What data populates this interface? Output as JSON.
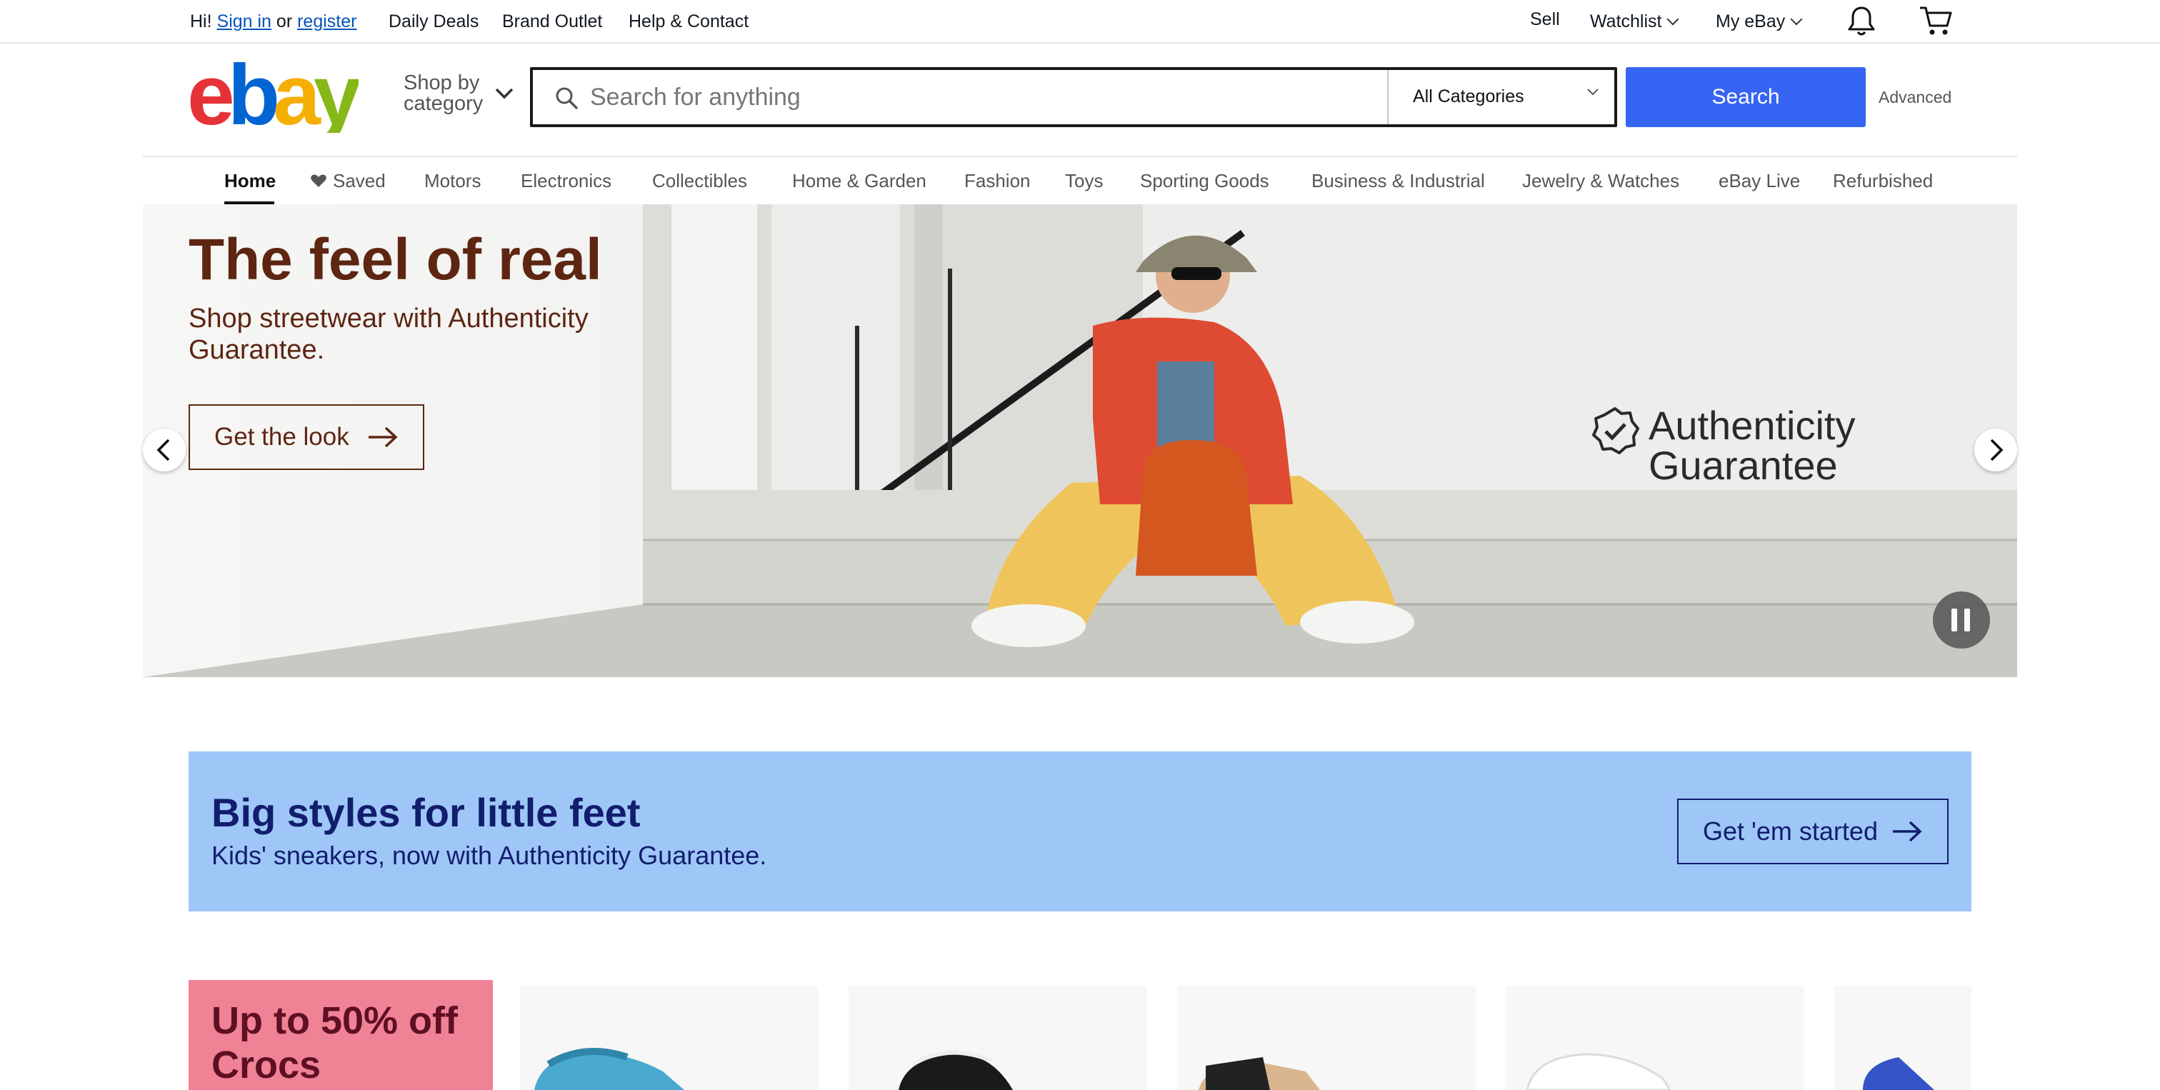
{
  "topbar": {
    "greeting": "Hi!",
    "sign_in": "Sign in",
    "or": "or",
    "register": "register",
    "daily_deals": "Daily Deals",
    "brand_outlet": "Brand Outlet",
    "help_contact": "Help & Contact",
    "sell": "Sell",
    "watchlist": "Watchlist",
    "my_ebay": "My eBay"
  },
  "header": {
    "shop_by_line1": "Shop by",
    "shop_by_line2": "category",
    "search_placeholder": "Search for anything",
    "category_selected": "All Categories",
    "search_button": "Search",
    "advanced": "Advanced"
  },
  "nav": {
    "items": [
      {
        "label": "Home"
      },
      {
        "label": "Saved"
      },
      {
        "label": "Motors"
      },
      {
        "label": "Electronics"
      },
      {
        "label": "Collectibles"
      },
      {
        "label": "Home & Garden"
      },
      {
        "label": "Fashion"
      },
      {
        "label": "Toys"
      },
      {
        "label": "Sporting Goods"
      },
      {
        "label": "Business & Industrial"
      },
      {
        "label": "Jewelry & Watches"
      },
      {
        "label": "eBay Live"
      },
      {
        "label": "Refurbished"
      }
    ],
    "active": "Home"
  },
  "hero": {
    "title": "The feel of real",
    "subtitle": "Shop streetwear with Authenticity Guarantee.",
    "cta": "Get the look",
    "badge_line1": "Authenticity",
    "badge_line2": "Guarantee"
  },
  "promo": {
    "title": "Big styles for little feet",
    "subtitle": "Kids' sneakers, now with Authenticity Guarantee.",
    "cta": "Get 'em started"
  },
  "crocs": {
    "title": "Up to 50% off Crocs"
  },
  "colors": {
    "search_blue": "#3665f3",
    "hero_text": "#5e2612",
    "promo_bg": "#9ec7f8",
    "promo_text": "#121d6d",
    "crocs_bg": "#f08296",
    "crocs_text": "#5e0f23"
  },
  "icons": [
    "ebay-logo",
    "chevron-down-icon",
    "bell-icon",
    "cart-icon",
    "search-icon",
    "heart-icon",
    "arrow-right-icon",
    "chevron-left-icon",
    "chevron-right-icon",
    "pause-icon",
    "authenticity-check-icon"
  ]
}
